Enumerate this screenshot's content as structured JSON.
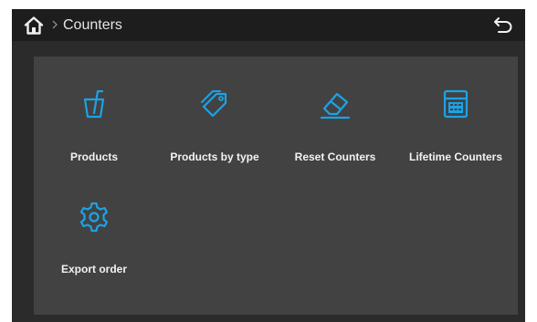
{
  "header": {
    "title": "Counters",
    "home_icon": "home-icon",
    "separator_icon": "chevron-right-icon",
    "back_icon": "back-arrow-icon"
  },
  "tiles": [
    {
      "label": "Products",
      "icon": "cup-straw-icon"
    },
    {
      "label": "Products by type",
      "icon": "tags-icon"
    },
    {
      "label": "Reset Counters",
      "icon": "eraser-icon"
    },
    {
      "label": "Lifetime Counters",
      "icon": "calculator-icon"
    },
    {
      "label": "Export order",
      "icon": "gear-icon"
    }
  ],
  "colors": {
    "accent": "#1aa3e8",
    "header_bg": "#1d1d1d",
    "screen_bg": "#2b2b2b",
    "panel_bg": "#424242",
    "text": "#f2f2f2"
  }
}
